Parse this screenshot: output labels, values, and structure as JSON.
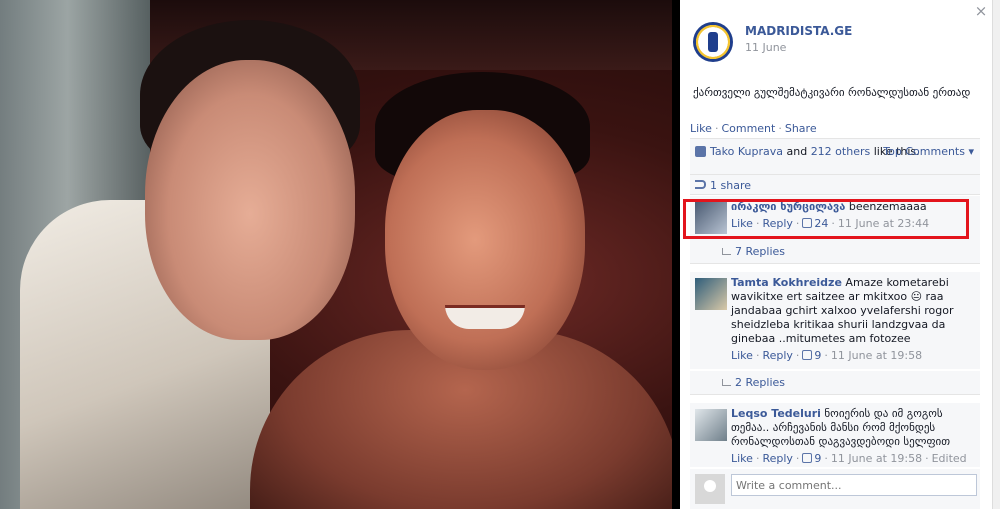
{
  "photo": {
    "description_icon": "photo"
  },
  "page": {
    "name": "MADRIDISTA.GE",
    "date": "11 June"
  },
  "post": {
    "text": "ქართველი გულშემატკივარი რონალდუსთან ერთად"
  },
  "actions": {
    "like": "Like",
    "comment": "Comment",
    "share": "Share"
  },
  "likes": {
    "person": "Tako Kuprava",
    "middle": " and ",
    "others": "212 others",
    "suffix": " like this.",
    "sort": "Top Comments ▾"
  },
  "shares": {
    "label": "1 share"
  },
  "comments": [
    {
      "name": "ირაკლი ხურცილავა",
      "text": "beenzemaaaa",
      "like": "Like",
      "reply": "Reply",
      "likes": "24",
      "time": "11 June at 23:44",
      "replies": "7 Replies"
    },
    {
      "name": "Tamta Kokhreidze",
      "text": "Amaze kometarebi wavikitxe ert saitzee ar mkitxoo 😐 raa jandabaa gchirt xalxoo yvelafershi rogor sheidzleba kritikaa shurii landzgvaa da ginebaa ..mitumetes am fotozee",
      "like": "Like",
      "reply": "Reply",
      "likes": "9",
      "time": "11 June at 19:58",
      "replies": "2 Replies"
    },
    {
      "name": "Leqso Tedeluri",
      "text": "ნოიერის და იმ გოგოს თემაა.. არჩევანის მანსი რომ მქონდეს რონალდოსთან დაგვავდებოდი სელფით",
      "like": "Like",
      "reply": "Reply",
      "likes": "9",
      "time": "11 June at 19:58",
      "edited": "Edited"
    }
  ],
  "composer": {
    "placeholder": "Write a comment..."
  },
  "colors": {
    "link": "#3b5998",
    "highlight": "#e3141c"
  }
}
